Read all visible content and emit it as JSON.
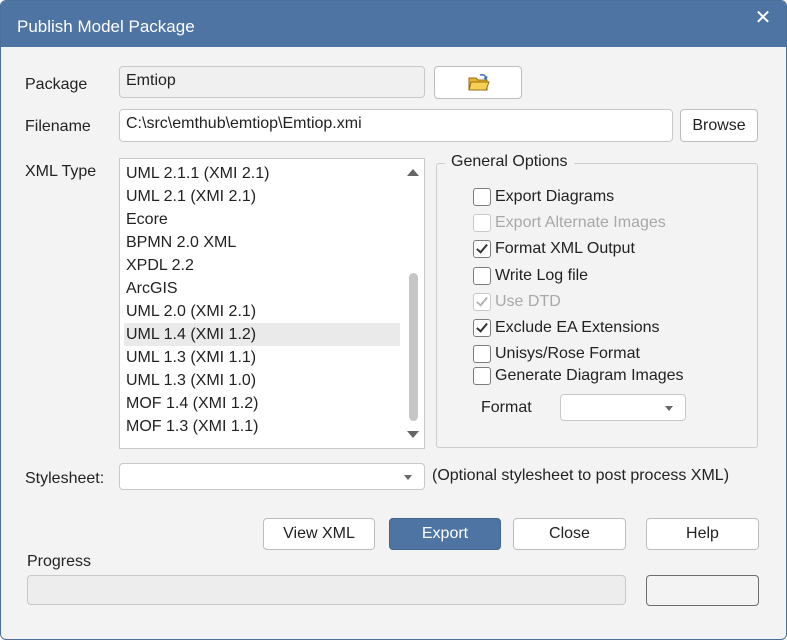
{
  "dialog": {
    "title": "Publish Model Package",
    "close_glyph": "✕"
  },
  "package": {
    "label": "Package",
    "value": "Emtiop",
    "browse_icon": "folder-open-icon"
  },
  "filename": {
    "label": "Filename",
    "value": "C:\\src\\emthub\\emtiop\\Emtiop.xmi",
    "browse_label": "Browse"
  },
  "xml_type": {
    "label": "XML Type",
    "selected": "UML 1.4 (XMI 1.2)",
    "items": [
      "UML 2.1.1 (XMI 2.1)",
      "UML 2.1 (XMI 2.1)",
      "Ecore",
      "BPMN 2.0 XML",
      "XPDL 2.2",
      "ArcGIS",
      "UML 2.0 (XMI 2.1)",
      "UML 1.4 (XMI 1.2)",
      "UML 1.3 (XMI 1.1)",
      "UML 1.3 (XMI 1.0)",
      "MOF 1.4 (XMI 1.2)",
      "MOF 1.3 (XMI 1.1)"
    ]
  },
  "general_options": {
    "title": "General Options",
    "options": [
      {
        "label": "Export Diagrams",
        "checked": false,
        "enabled": true
      },
      {
        "label": "Export Alternate Images",
        "checked": false,
        "enabled": false
      },
      {
        "label": "Format XML Output",
        "checked": true,
        "enabled": true
      },
      {
        "label": "Write Log file",
        "checked": false,
        "enabled": true
      },
      {
        "label": "Use DTD",
        "checked": true,
        "enabled": false
      },
      {
        "label": "Exclude EA Extensions",
        "checked": true,
        "enabled": true
      },
      {
        "label": "Unisys/Rose Format",
        "checked": false,
        "enabled": true
      },
      {
        "label": "Generate Diagram Images",
        "checked": false,
        "enabled": true
      }
    ],
    "format_label": "Format",
    "format_value": ""
  },
  "stylesheet": {
    "label": "Stylesheet:",
    "value": "",
    "hint": "(Optional stylesheet to post process XML)"
  },
  "buttons": {
    "view_xml": "View XML",
    "export": "Export",
    "close": "Close",
    "help": "Help"
  },
  "progress": {
    "label": "Progress"
  },
  "colors": {
    "titlebar": "#4d74a3",
    "accent": "#4d74a3"
  }
}
